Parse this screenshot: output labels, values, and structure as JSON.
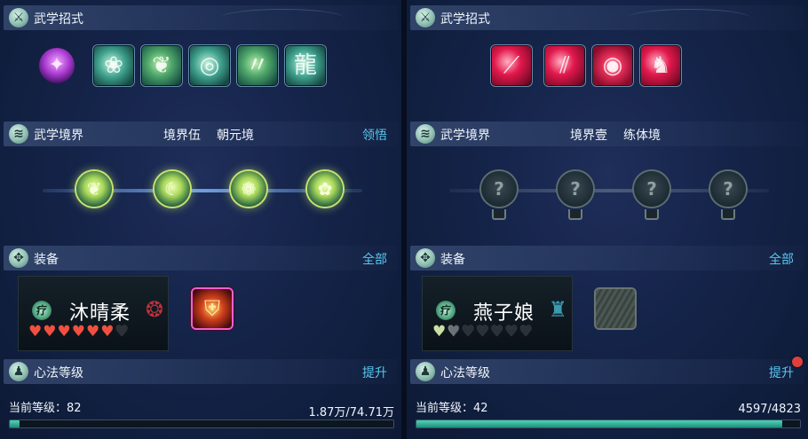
{
  "panels": [
    {
      "skills_title": "武学招式",
      "skills": [
        "inner-martial-icon",
        "green-wind-skill-icon",
        "green-leaf-skill-icon",
        "green-vortex-skill-icon",
        "green-slash-skill-icon",
        "green-dragon-skill-icon"
      ],
      "realm": {
        "title": "武学境界",
        "tier": "境界伍",
        "name": "朝元境",
        "action": "领悟",
        "nodes": 4,
        "unlocked": 4
      },
      "equip": {
        "title": "装备",
        "action": "全部",
        "character": {
          "class_badge": "疗",
          "name": "沐晴柔",
          "hearts_filled": 6,
          "hearts_total": 7,
          "heart_color": "#f05040"
        },
        "item": "armor-icon"
      },
      "heart_method": {
        "title": "心法等级",
        "action": "提升",
        "level_label": "当前等级：82",
        "progress_text": "1.87万/74.71万",
        "progress": 0.025,
        "badge": false
      }
    },
    {
      "skills_title": "武学招式",
      "skills": [
        "crimson-blade-icon",
        "crimson-claw-icon",
        "crimson-orb-icon",
        "crimson-warrior-icon"
      ],
      "realm": {
        "title": "武学境界",
        "tier": "境界壹",
        "name": "练体境",
        "action": "",
        "nodes": 4,
        "unlocked": 0
      },
      "equip": {
        "title": "装备",
        "action": "全部",
        "character": {
          "class_badge": "疗",
          "name": "燕子娘",
          "hearts_filled": 1.5,
          "hearts_total": 7,
          "heart_color": "#c9e0a2"
        },
        "item": "empty-slot"
      },
      "heart_method": {
        "title": "心法等级",
        "action": "提升",
        "level_label": "当前等级：42",
        "progress_text": "4597/4823",
        "progress": 0.953,
        "badge": true
      }
    }
  ],
  "colors": {
    "link": "#58c8f0",
    "progress": "#2fb39a",
    "badge": "#e0403a"
  }
}
